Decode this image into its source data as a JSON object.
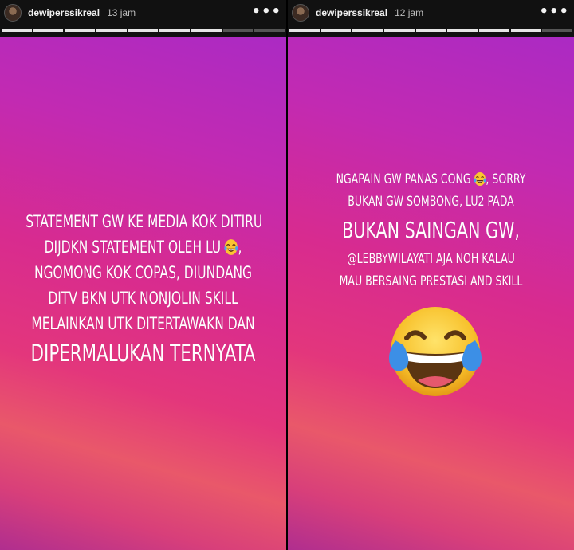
{
  "stories": [
    {
      "username": "dewiperssikreal",
      "time": "13 jam",
      "progress": {
        "segments": 9,
        "completed": 7
      },
      "text_lines": [
        "STATEMENT GW KE MEDIA KOK DITIRU",
        "DIJDKN STATEMENT OLEH LU",
        "NGOMONG KOK COPAS, DIUNDANG",
        "DITV BKN UTK NONJOLIN SKILL",
        "MELAINKAN UTK DITERTAWAKN DAN",
        "DIPERMALUKAN TERNYATA"
      ],
      "emoji": "tears-of-joy-emoji"
    },
    {
      "username": "dewiperssikreal",
      "time": "12 jam",
      "progress": {
        "segments": 9,
        "completed": 8
      },
      "text_lines": [
        "NGAPAIN GW PANAS CONG",
        ", SORRY",
        "BUKAN GW SOMBONG, LU2 PADA",
        "BUKAN SAINGAN GW,",
        "@LEBBYWILAYATI AJA NOH KALAU",
        "MAU BERSAING PRESTASI AND SKILL"
      ],
      "emoji": "tears-of-joy-emoji"
    }
  ],
  "colors": {
    "header_bg": "#111111",
    "gradient": [
      "#a52ac8",
      "#d82b8f",
      "#e9586a"
    ]
  }
}
